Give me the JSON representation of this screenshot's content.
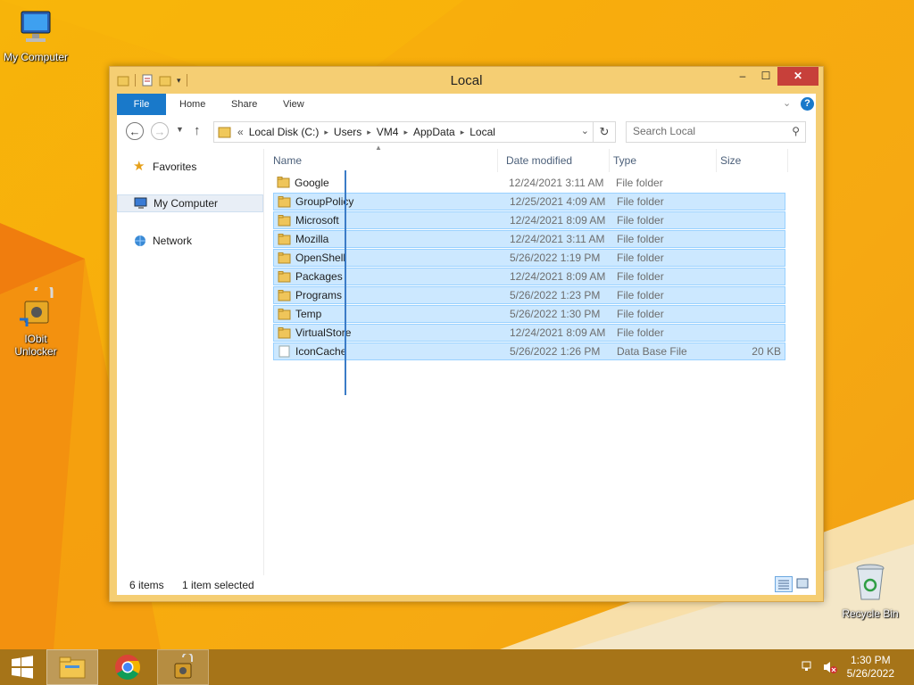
{
  "desktop": {
    "icons": [
      {
        "label": "My Computer",
        "icon": "computer-icon"
      },
      {
        "label": "IObit Unlocker",
        "icon": "unlocker-icon"
      },
      {
        "label": "Recycle Bin",
        "icon": "recycle-bin-icon"
      }
    ]
  },
  "window": {
    "title": "Local",
    "controls": {
      "minimize": "–",
      "maximize": "☐",
      "close": "✕"
    },
    "ribbon_tabs": [
      {
        "label": "File",
        "active": true
      },
      {
        "label": "Home"
      },
      {
        "label": "Share"
      },
      {
        "label": "View"
      }
    ],
    "breadcrumb": {
      "prefix": "«",
      "items": [
        "Local Disk (C:)",
        "Users",
        "VM4",
        "AppData",
        "Local"
      ]
    },
    "search_placeholder": "Search Local",
    "nav": [
      {
        "label": "Favorites",
        "icon": "star-icon"
      },
      {
        "label": "My Computer",
        "icon": "computer-icon",
        "selected": true
      },
      {
        "label": "Network",
        "icon": "network-icon"
      }
    ],
    "columns": [
      "Name",
      "Date modified",
      "Type",
      "Size"
    ],
    "files": [
      {
        "name": "Google",
        "date": "12/24/2021 3:11 AM",
        "type": "File folder",
        "size": "",
        "selected": false,
        "icon": "folder-icon"
      },
      {
        "name": "GroupPolicy",
        "date": "12/25/2021 4:09 AM",
        "type": "File folder",
        "size": "",
        "selected": true,
        "icon": "folder-icon"
      },
      {
        "name": "Microsoft",
        "date": "12/24/2021 8:09 AM",
        "type": "File folder",
        "size": "",
        "selected": true,
        "icon": "folder-icon"
      },
      {
        "name": "Mozilla",
        "date": "12/24/2021 3:11 AM",
        "type": "File folder",
        "size": "",
        "selected": true,
        "icon": "folder-icon"
      },
      {
        "name": "OpenShell",
        "date": "5/26/2022 1:19 PM",
        "type": "File folder",
        "size": "",
        "selected": true,
        "icon": "folder-icon"
      },
      {
        "name": "Packages",
        "date": "12/24/2021 8:09 AM",
        "type": "File folder",
        "size": "",
        "selected": true,
        "icon": "folder-icon"
      },
      {
        "name": "Programs",
        "date": "5/26/2022 1:23 PM",
        "type": "File folder",
        "size": "",
        "selected": true,
        "icon": "folder-icon"
      },
      {
        "name": "Temp",
        "date": "5/26/2022 1:30 PM",
        "type": "File folder",
        "size": "",
        "selected": true,
        "icon": "folder-icon"
      },
      {
        "name": "VirtualStore",
        "date": "12/24/2021 8:09 AM",
        "type": "File folder",
        "size": "",
        "selected": true,
        "icon": "folder-icon"
      },
      {
        "name": "IconCache",
        "date": "5/26/2022 1:26 PM",
        "type": "Data Base File",
        "size": "20 KB",
        "selected": true,
        "icon": "file-icon"
      }
    ],
    "status": {
      "item_count": "6 items",
      "selection": "1 item selected"
    }
  },
  "taskbar": {
    "apps": [
      {
        "name": "File Explorer",
        "icon": "file-explorer-icon",
        "active": true
      },
      {
        "name": "Google Chrome",
        "icon": "chrome-icon",
        "active": false
      },
      {
        "name": "IObit Unlocker",
        "icon": "unlocker-icon",
        "active": true
      }
    ],
    "clock_time": "1:30 PM",
    "clock_date": "5/26/2022"
  }
}
